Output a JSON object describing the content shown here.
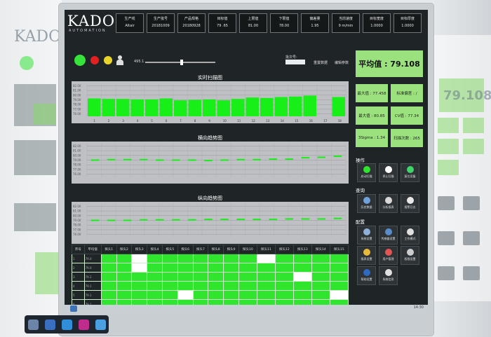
{
  "app": {
    "logo": "KADO",
    "logo_sub": "AUTOMATION"
  },
  "stats": [
    {
      "label": "生产线",
      "value": "Altair"
    },
    {
      "label": "生产批号",
      "value": "20181009"
    },
    {
      "label": "产品规格",
      "value": "20180928"
    },
    {
      "label": "目标值",
      "value": "79 .65"
    },
    {
      "label": "上限值",
      "value": "81.00"
    },
    {
      "label": "下限值",
      "value": "78.00"
    },
    {
      "label": "偏差量",
      "value": "1.95"
    },
    {
      "label": "当前速度",
      "value": "9 m/min"
    },
    {
      "label": "目标宽度",
      "value": "1.0000"
    },
    {
      "label": "目标厚度",
      "value": "1.0000"
    }
  ],
  "controls": {
    "slider_value": "495.1",
    "barcode_label": "批次号:",
    "barcode_placeholder": "",
    "link_1": "重置数据",
    "link_2": "编辑参数"
  },
  "charts": {
    "realtime_title": "实时扫描图",
    "lateral_title": "横向趋势图",
    "longitudinal_title": "纵向趋势图"
  },
  "chart_data": [
    {
      "type": "bar",
      "title": "实时扫描图",
      "categories": [
        "1",
        "2",
        "3",
        "4",
        "5",
        "6",
        "7",
        "8",
        "9",
        "10",
        "11",
        "12",
        "13",
        "14",
        "15",
        "16",
        "17",
        "18"
      ],
      "values": [
        79.3,
        79.2,
        79.2,
        79.1,
        79.1,
        79.3,
        78.9,
        79.0,
        79.1,
        78.9,
        79.2,
        79.5,
        79.4,
        79.6,
        79.7,
        79.9,
        null,
        79.6
      ],
      "ylim": [
        75.5,
        82.5
      ],
      "ytick_labels": [
        "82.00",
        "81.00",
        "80.00",
        "79.00",
        "78.00",
        "77.00",
        "76.00"
      ]
    },
    {
      "type": "line",
      "title": "横向趋势图",
      "series": [
        {
          "values": [
            79.0,
            79.1,
            79.1,
            79.1,
            79.0,
            79.0,
            79.0,
            78.9,
            79.0,
            79.1,
            79.1,
            79.2,
            79.2,
            79.5,
            79.6,
            79.8
          ]
        }
      ],
      "ylim": [
        75.5,
        82.5
      ],
      "ytick_labels": [
        "82.00",
        "81.00",
        "80.00",
        "79.00",
        "78.00",
        "77.00",
        "76.00"
      ]
    },
    {
      "type": "line",
      "title": "纵向趋势图",
      "series": [
        {
          "values": [
            79.0,
            79.0,
            79.0,
            79.1,
            79.1,
            79.1,
            79.1,
            79.2,
            79.2,
            79.2,
            79.2,
            79.2,
            79.3,
            79.3,
            79.3,
            79.4
          ]
        }
      ],
      "ylim": [
        75.5,
        82.5
      ],
      "ytick_labels": [
        "82.00",
        "81.00",
        "80.00",
        "79.00",
        "78.00",
        "77.00",
        "76.00"
      ]
    }
  ],
  "table": {
    "headers": [
      "序号",
      "平均值",
      "探头1",
      "探头2",
      "探头3",
      "探头4",
      "探头5",
      "探头6",
      "探头7",
      "探头8",
      "探头9",
      "探头10",
      "探头11",
      "探头12",
      "探头13",
      "探头14",
      "探头15"
    ],
    "rows": [
      [
        "1",
        "79.0",
        "ok",
        "ok",
        "no",
        "ok",
        "ok",
        "ok",
        "ok",
        "ok",
        "ok",
        "ok",
        "no",
        "ok",
        "ok",
        "ok",
        "ok"
      ],
      [
        "2",
        "79.0",
        "ok",
        "ok",
        "no",
        "ok",
        "ok",
        "ok",
        "ok",
        "ok",
        "ok",
        "ok",
        "ok",
        "ok",
        "ok",
        "ok",
        "ok"
      ],
      [
        "3",
        "79.1",
        "ok",
        "ok",
        "ok",
        "ok",
        "ok",
        "ok",
        "ok",
        "ok",
        "ok",
        "ok",
        "ok",
        "ok",
        "no",
        "ok",
        "ok"
      ],
      [
        "4",
        "79.1",
        "ok",
        "ok",
        "ok",
        "ok",
        "ok",
        "ok",
        "ok",
        "ok",
        "ok",
        "ok",
        "ok",
        "ok",
        "ok",
        "ok",
        "ok"
      ],
      [
        "5",
        "79.1",
        "ok",
        "ok",
        "ok",
        "ok",
        "ok",
        "no",
        "ok",
        "ok",
        "ok",
        "ok",
        "ok",
        "ok",
        "ok",
        "ok",
        "no"
      ],
      [
        "6",
        "79.1",
        "ok",
        "ok",
        "ok",
        "ok",
        "ok",
        "ok",
        "ok",
        "ok",
        "ok",
        "ok",
        "ok",
        "ok",
        "ok",
        "ok",
        "ok"
      ]
    ]
  },
  "right_panel": {
    "average_label": "平均值 : 79.108",
    "mini": [
      {
        "label": "最大值 : 77.458"
      },
      {
        "label": "标准偏差 : /"
      },
      {
        "label": "最大值 : 80.85"
      },
      {
        "label": "CV值 : 77.34"
      },
      {
        "label": "3Sigma : 1.34"
      },
      {
        "label": "扫描次数 : 265"
      }
    ],
    "sections": {
      "operation": "操作",
      "query": "查询",
      "config": "配置"
    },
    "operation_tools": [
      {
        "label": "启动扫描",
        "color": "#2fe52d"
      },
      {
        "label": "停止扫描",
        "color": "#ffffff"
      },
      {
        "label": "复位设备",
        "color": "#3fd36a"
      }
    ],
    "query_tools": [
      {
        "label": "历史数据",
        "color": "#6fa2d8"
      },
      {
        "label": "分析报表",
        "color": "#d8d8d8"
      },
      {
        "label": "报警日志",
        "color": "#e8e8e8"
      }
    ],
    "config_tools": [
      {
        "label": "系统设置",
        "color": "#8fb0d8"
      },
      {
        "label": "传感器设置",
        "color": "#5a8cc7"
      },
      {
        "label": "工作模式",
        "color": "#e0e0e0"
      },
      {
        "label": "报表设置",
        "color": "#e8b93a"
      },
      {
        "label": "用户管理",
        "color": "#e25555"
      },
      {
        "label": "权限设置",
        "color": "#cccccc"
      },
      {
        "label": "帮助设置",
        "color": "#2f69c0"
      },
      {
        "label": "系统信息",
        "color": "#e0e0e0"
      }
    ]
  },
  "taskbar": {
    "time": "14:30"
  },
  "colors": {
    "good": "#2fe52d",
    "panel": "#9be27e",
    "background": "#1f2427"
  }
}
